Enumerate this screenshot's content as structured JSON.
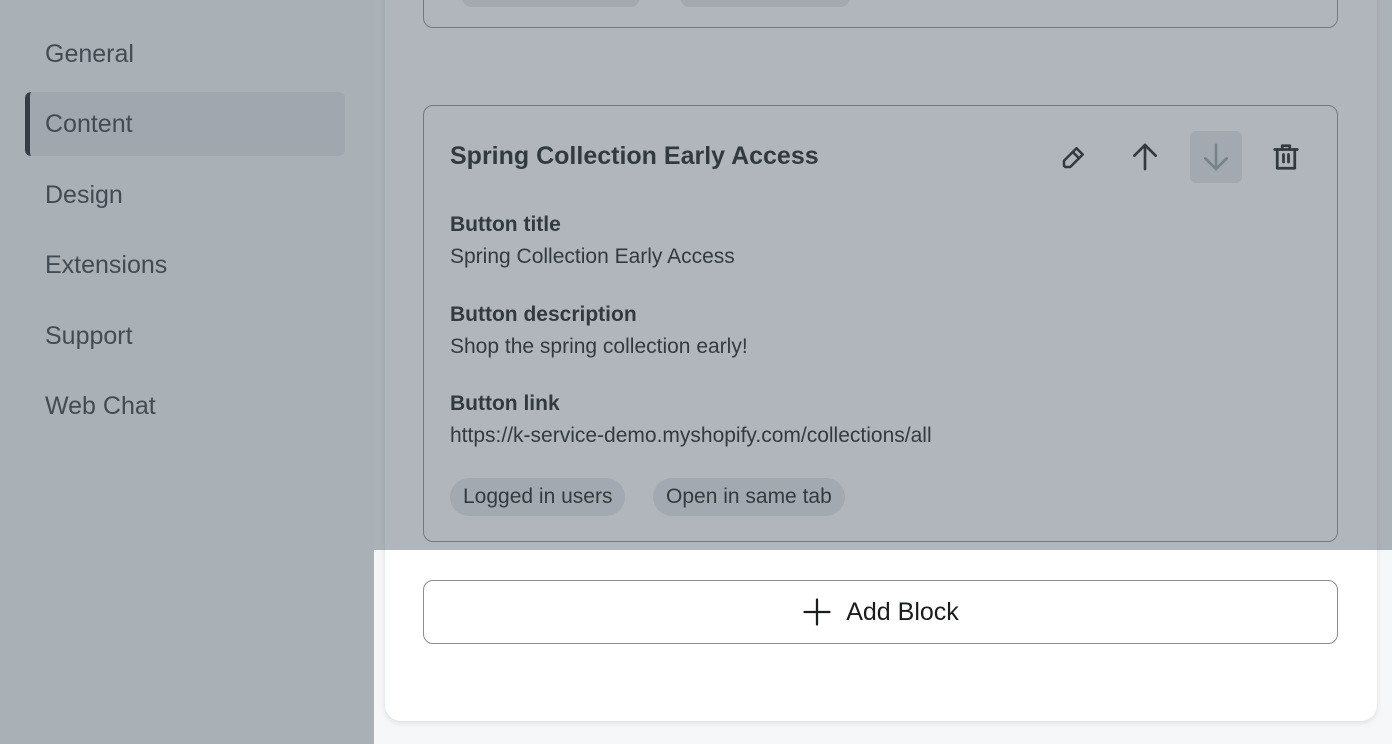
{
  "sidebar": {
    "items": [
      {
        "label": "General",
        "active": false
      },
      {
        "label": "Content",
        "active": true
      },
      {
        "label": "Design",
        "active": false
      },
      {
        "label": "Extensions",
        "active": false
      },
      {
        "label": "Support",
        "active": false
      },
      {
        "label": "Web Chat",
        "active": false
      }
    ]
  },
  "block": {
    "title": "Spring Collection Early Access",
    "actions": [
      {
        "icon": "pencil-icon",
        "label": "Edit",
        "enabled": true
      },
      {
        "icon": "arrow-up-icon",
        "label": "Move up",
        "enabled": true
      },
      {
        "icon": "arrow-down-icon",
        "label": "Move down",
        "enabled": false
      },
      {
        "icon": "trash-icon",
        "label": "Delete",
        "enabled": true
      }
    ],
    "fields": [
      {
        "label": "Button title",
        "value": "Spring Collection Early Access"
      },
      {
        "label": "Button description",
        "value": "Shop the spring collection early!"
      },
      {
        "label": "Button link",
        "value": "https://k-service-demo.myshopify.com/collections/all"
      }
    ],
    "tags": [
      "Logged in users",
      "Open in same tab"
    ]
  },
  "add_block": {
    "label": "Add Block",
    "icon": "plus-icon"
  }
}
